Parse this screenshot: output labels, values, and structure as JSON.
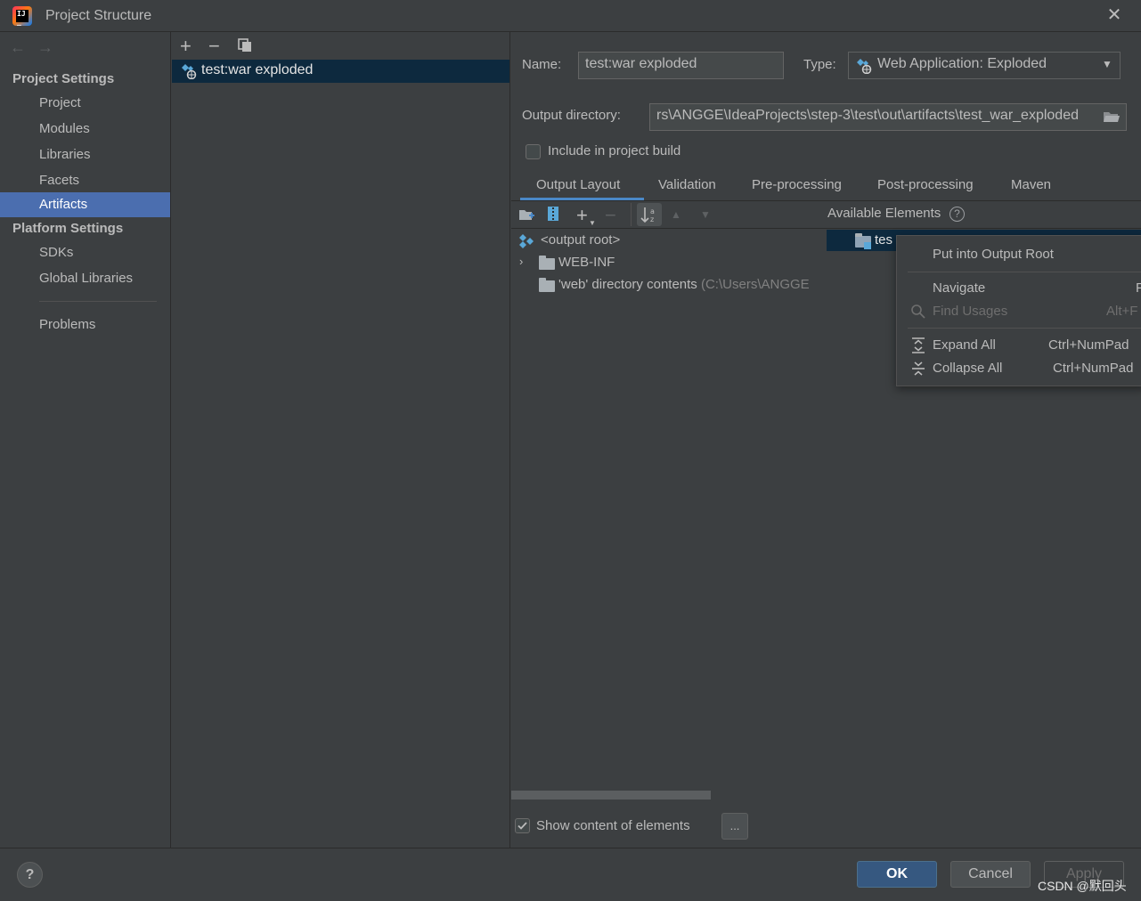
{
  "window": {
    "title": "Project Structure"
  },
  "sidebar": {
    "project_settings_header": "Project Settings",
    "project_items": [
      "Project",
      "Modules",
      "Libraries",
      "Facets",
      "Artifacts"
    ],
    "selected_item": "Artifacts",
    "platform_settings_header": "Platform Settings",
    "platform_items": [
      "SDKs",
      "Global Libraries"
    ],
    "problems_label": "Problems"
  },
  "artifacts": {
    "items": [
      "test:war exploded"
    ]
  },
  "editor": {
    "name_label": "Name:",
    "name_value": "test:war exploded",
    "type_label": "Type:",
    "type_value": "Web Application: Exploded",
    "output_dir_label": "Output directory:",
    "output_dir_value": "rs\\ANGGE\\IdeaProjects\\step-3\\test\\out\\artifacts\\test_war_exploded",
    "include_build_label": "Include in project build",
    "tabs": [
      "Output Layout",
      "Validation",
      "Pre-processing",
      "Post-processing",
      "Maven"
    ],
    "active_tab": "Output Layout",
    "available_elements_label": "Available Elements",
    "tree": {
      "root": "<output root>",
      "webinf": "WEB-INF",
      "web_contents": "'web' directory contents",
      "web_contents_path": "(C:\\Users\\ANGGE"
    },
    "available_item": "tes",
    "show_content_label": "Show content of elements",
    "ellipsis_button": "..."
  },
  "context_menu": {
    "items": [
      {
        "label": "Put into Output Root",
        "shortcut": "",
        "enabled": true,
        "icon": ""
      },
      {
        "label": "Navigate",
        "shortcut": "F",
        "enabled": true,
        "icon": ""
      },
      {
        "label": "Find Usages",
        "shortcut": "Alt+F",
        "enabled": false,
        "icon": "search-icon"
      },
      {
        "label": "Expand All",
        "shortcut": "Ctrl+NumPad",
        "enabled": true,
        "icon": "expand-all-icon"
      },
      {
        "label": "Collapse All",
        "shortcut": "Ctrl+NumPad",
        "enabled": true,
        "icon": "collapse-all-icon"
      }
    ]
  },
  "footer": {
    "help": "?",
    "ok": "OK",
    "cancel": "Cancel",
    "apply": "Apply",
    "watermark": "CSDN @默回头"
  },
  "colors": {
    "background": "#3c3f41",
    "selection": "#4b6eaf",
    "selection_inactive": "#0d293e",
    "primary_button": "#365880",
    "tab_underline": "#4a88c7"
  }
}
